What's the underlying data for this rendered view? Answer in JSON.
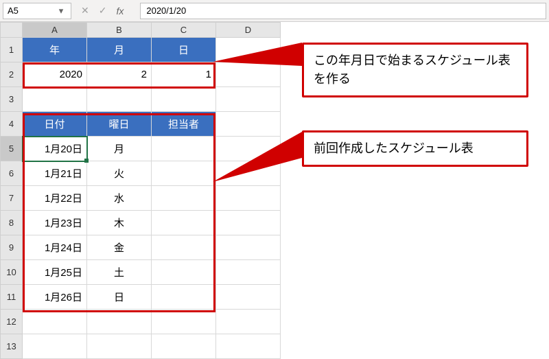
{
  "namebox": "A5",
  "formula_bar": "2020/1/20",
  "columns": [
    "A",
    "B",
    "C",
    "D"
  ],
  "rows": [
    "1",
    "2",
    "3",
    "4",
    "5",
    "6",
    "7",
    "8",
    "9",
    "10",
    "11",
    "12",
    "13"
  ],
  "header1": {
    "A": "年",
    "B": "月",
    "C": "日"
  },
  "values_row2": {
    "A": "2020",
    "B": "2",
    "C": "1"
  },
  "header4": {
    "A": "日付",
    "B": "曜日",
    "C": "担当者"
  },
  "schedule": [
    {
      "date": "1月20日",
      "dow": "月"
    },
    {
      "date": "1月21日",
      "dow": "火"
    },
    {
      "date": "1月22日",
      "dow": "水"
    },
    {
      "date": "1月23日",
      "dow": "木"
    },
    {
      "date": "1月24日",
      "dow": "金"
    },
    {
      "date": "1月25日",
      "dow": "土"
    },
    {
      "date": "1月26日",
      "dow": "日"
    }
  ],
  "callout1": "この年月日で始まるスケジュール表を作る",
  "callout2": "前回作成したスケジュール表",
  "selected_cell": "A5"
}
